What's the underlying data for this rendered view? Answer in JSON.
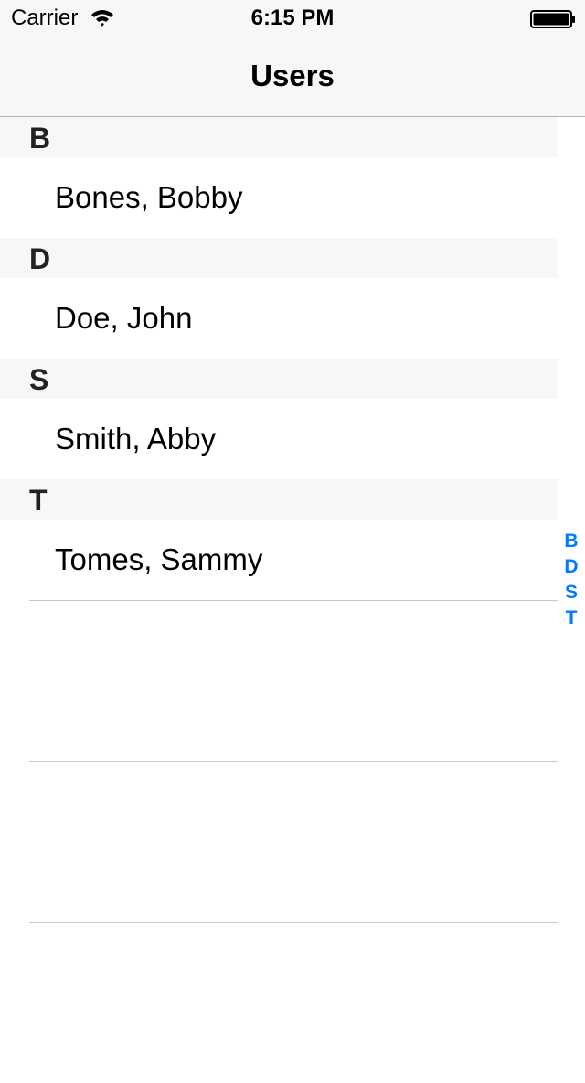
{
  "status_bar": {
    "carrier": "Carrier",
    "time": "6:15 PM"
  },
  "nav": {
    "title": "Users"
  },
  "sections": [
    {
      "letter": "B",
      "rows": [
        "Bones, Bobby"
      ]
    },
    {
      "letter": "D",
      "rows": [
        "Doe, John"
      ]
    },
    {
      "letter": "S",
      "rows": [
        "Smith, Abby"
      ]
    },
    {
      "letter": "T",
      "rows": [
        "Tomes, Sammy"
      ]
    }
  ],
  "index": [
    "B",
    "D",
    "S",
    "T"
  ],
  "colors": {
    "accent": "#007aff",
    "header_bg": "#f7f7f7",
    "separator": "#c8c7cc"
  }
}
